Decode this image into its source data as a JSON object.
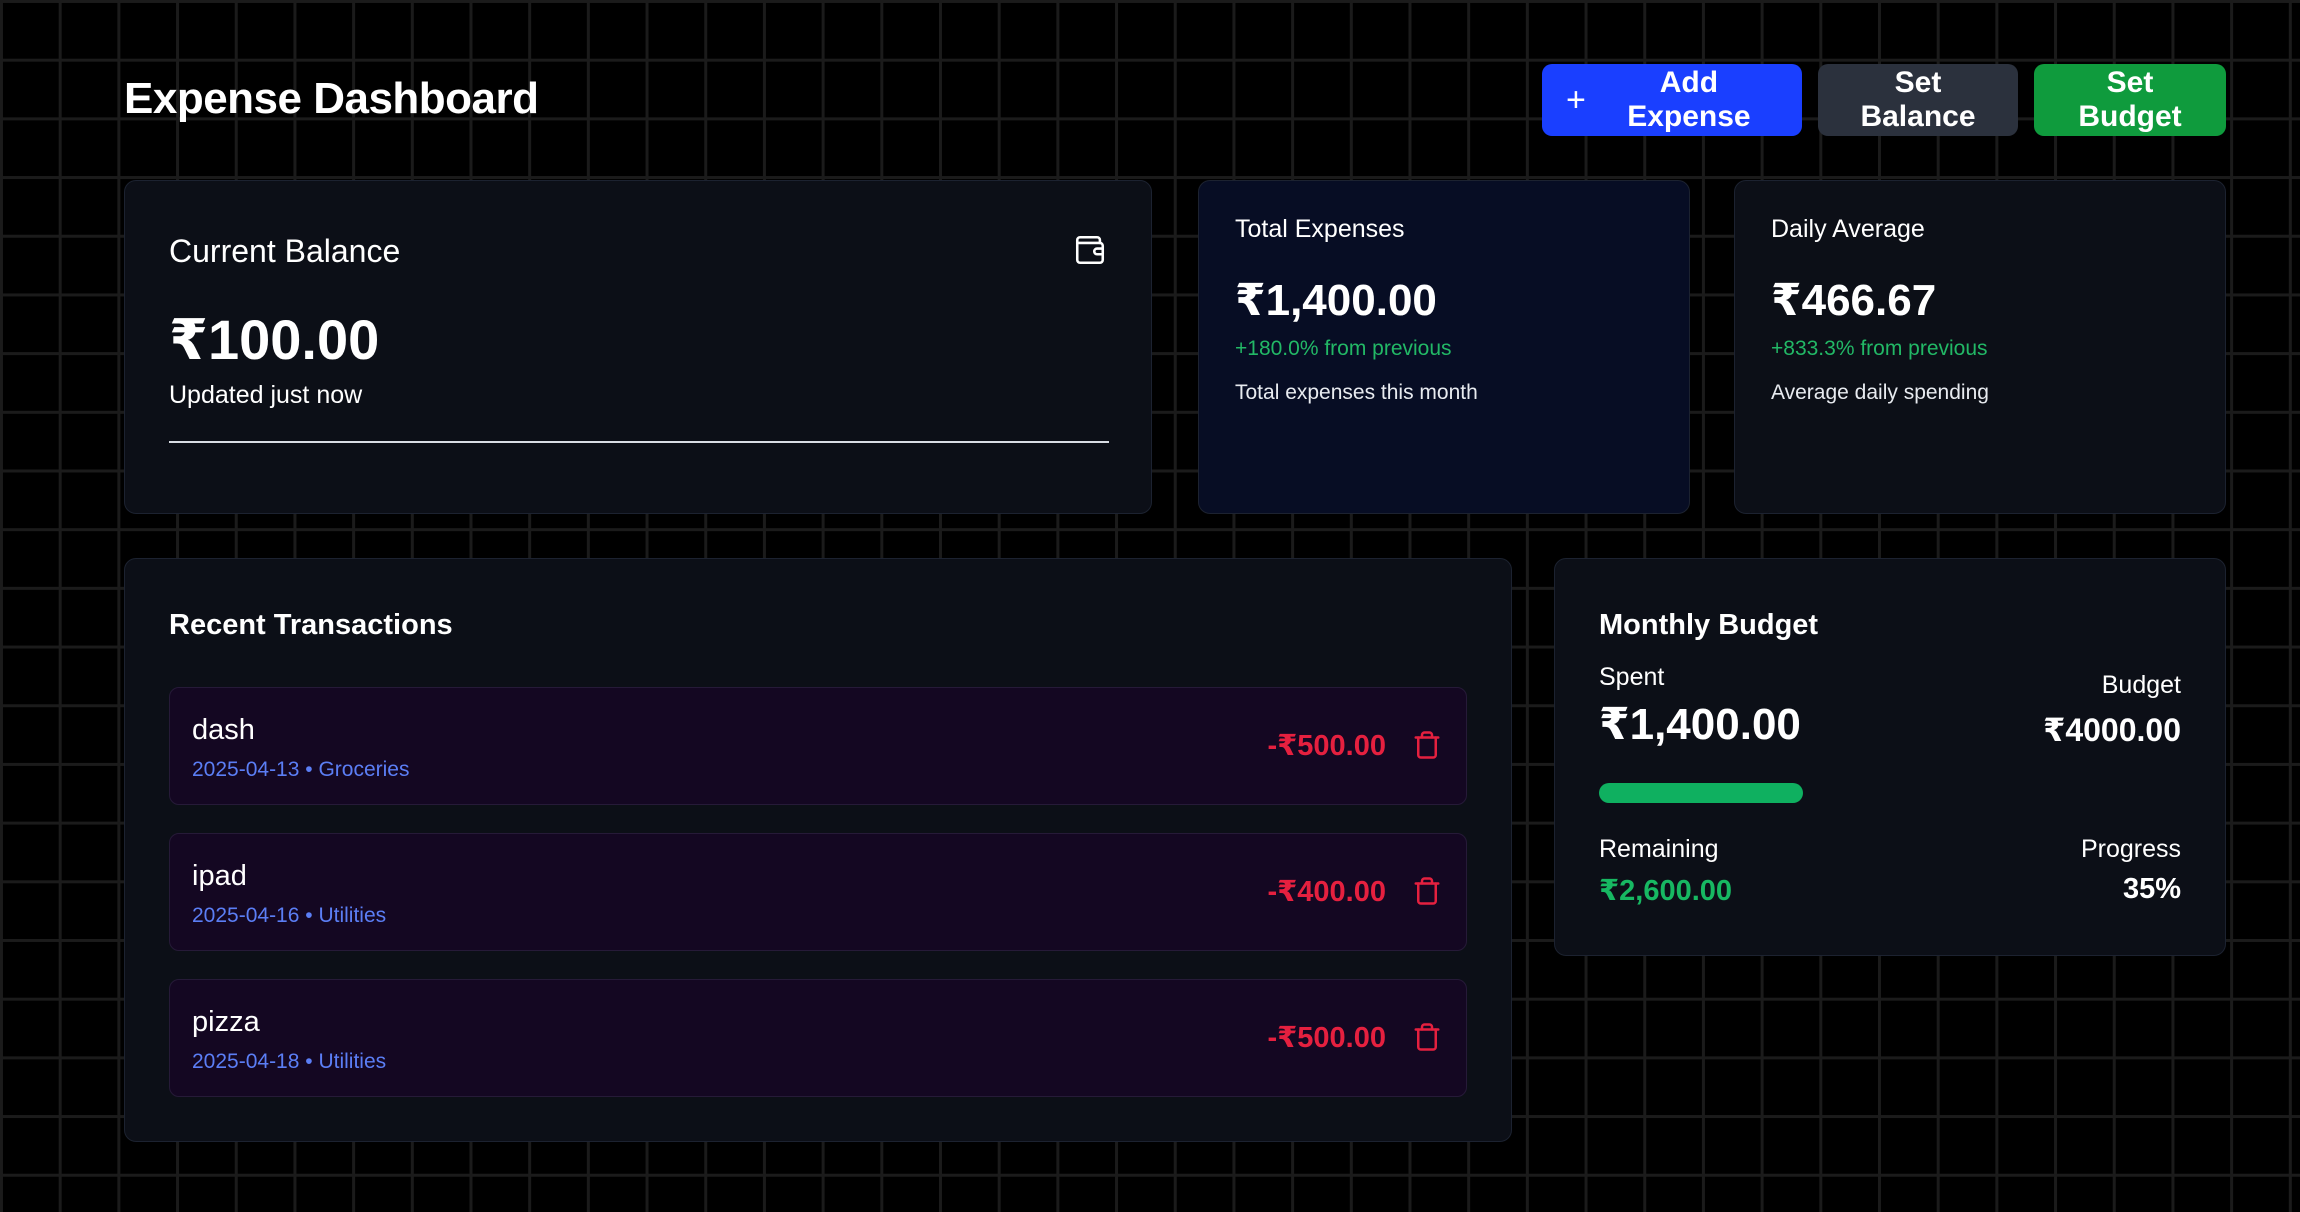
{
  "header": {
    "title": "Expense Dashboard",
    "add_expense_label": "Add Expense",
    "set_balance_label": "Set Balance",
    "set_budget_label": "Set Budget"
  },
  "balance_card": {
    "title": "Current Balance",
    "amount": "₹100.00",
    "updated": "Updated just now",
    "icon": "wallet-icon"
  },
  "total_expenses": {
    "title": "Total Expenses",
    "amount": "₹1,400.00",
    "change": "+180.0% from previous",
    "description": "Total expenses this month"
  },
  "daily_average": {
    "title": "Daily Average",
    "amount": "₹466.67",
    "change": "+833.3% from previous",
    "description": "Average daily spending"
  },
  "transactions": {
    "title": "Recent Transactions",
    "items": [
      {
        "name": "dash",
        "meta": "2025-04-13 • Groceries",
        "amount": "-₹500.00"
      },
      {
        "name": "ipad",
        "meta": "2025-04-16 • Utilities",
        "amount": "-₹400.00"
      },
      {
        "name": "pizza",
        "meta": "2025-04-18 • Utilities",
        "amount": "-₹500.00"
      }
    ]
  },
  "budget": {
    "title": "Monthly Budget",
    "spent_label": "Spent",
    "spent": "₹1,400.00",
    "budget_label": "Budget",
    "budget": "₹4000.00",
    "remaining_label": "Remaining",
    "remaining": "₹2,600.00",
    "progress_label": "Progress",
    "progress_text": "35%",
    "progress_fraction": 0.35
  },
  "colors": {
    "accent_blue": "#1a3fff",
    "success_green": "#0f9b3d",
    "expense_red": "#e5203f",
    "meta_blue": "#5b7ef5"
  }
}
